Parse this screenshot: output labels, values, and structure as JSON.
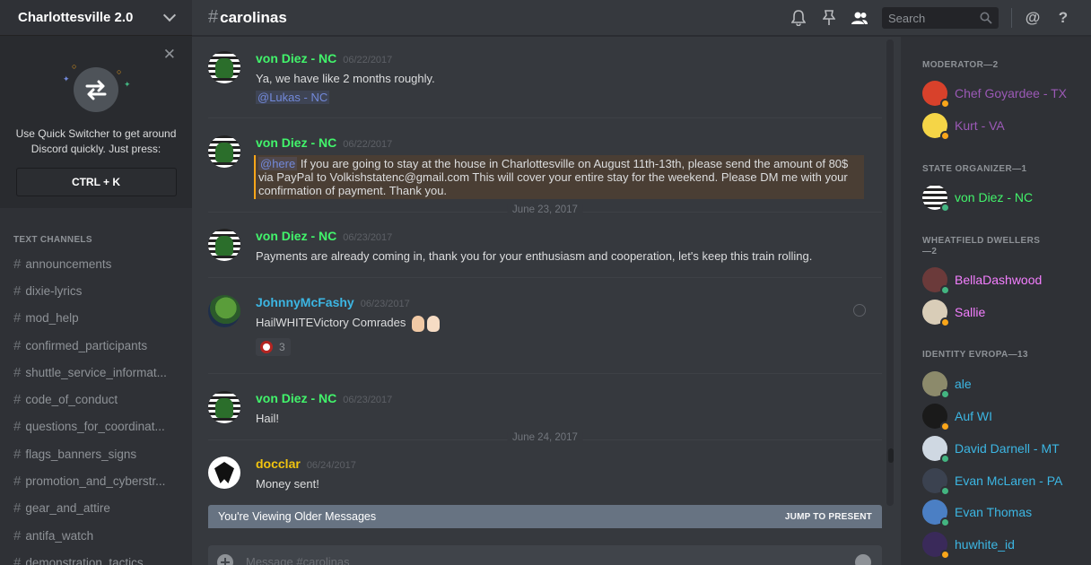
{
  "server": {
    "name": "Charlottesville 2.0"
  },
  "quick_switcher": {
    "text": "Use Quick Switcher to get around Discord quickly. Just press:",
    "shortcut": "CTRL + K"
  },
  "sidebar": {
    "category": "TEXT CHANNELS",
    "channels": [
      "announcements",
      "dixie-lyrics",
      "mod_help",
      "confirmed_participants",
      "shuttle_service_informat...",
      "code_of_conduct",
      "questions_for_coordinat...",
      "flags_banners_signs",
      "promotion_and_cyberstr...",
      "gear_and_attire",
      "antifa_watch",
      "demonstration_tactics"
    ]
  },
  "header": {
    "hash": "#",
    "channel": "carolinas",
    "search_placeholder": "Search"
  },
  "messages": [
    {
      "author": "von Diez - NC",
      "author_color": "#42f46b",
      "time": "06/22/2017",
      "lines": [
        "Ya, we have like 2 months roughly."
      ],
      "mention": "@Lukas - NC"
    },
    {
      "author": "von Diez - NC",
      "author_color": "#42f46b",
      "time": "06/22/2017",
      "here": "@here",
      "highlight_text": " If you are going to stay at the house in Charlottesville on August 11th-13th, please send the amount of 80$ via PayPal to Volkishstatenc@gmail.com This will cover your entire stay for the weekend. Please DM me with your confirmation of payment. Thank you."
    },
    {
      "author": "von Diez - NC",
      "author_color": "#42f46b",
      "time": "06/23/2017",
      "lines": [
        "Payments are already coming in, thank you for your enthusiasm and cooperation, let's keep this train rolling."
      ]
    },
    {
      "author": "JohnnyMcFashy",
      "author_color": "#3cb6e3",
      "time": "06/23/2017",
      "lines": [
        "HailWHITEVictory Comrades"
      ],
      "reaction_count": "3"
    },
    {
      "author": "von Diez - NC",
      "author_color": "#42f46b",
      "time": "06/23/2017",
      "lines": [
        "Hail!"
      ]
    },
    {
      "author": "docclar",
      "author_color": "#f1c40f",
      "time": "06/24/2017",
      "lines": [
        "Money sent!"
      ]
    }
  ],
  "date_dividers": [
    "June 23, 2017",
    "June 24, 2017"
  ],
  "older_bar": {
    "text": "You're Viewing Older Messages",
    "jump": "JUMP TO PRESENT"
  },
  "composer": {
    "placeholder": "Message #carolinas"
  },
  "members": {
    "roles": [
      {
        "title": "MODERATOR—2",
        "members": [
          {
            "name": "Chef Goyardee - TX",
            "color": "#9b59b6",
            "status": "#faa61a"
          },
          {
            "name": "Kurt - VA",
            "color": "#9b59b6",
            "status": "#faa61a"
          }
        ]
      },
      {
        "title": "STATE ORGANIZER—1",
        "members": [
          {
            "name": "von Diez - NC",
            "color": "#42f46b",
            "status": "#43b581"
          }
        ]
      },
      {
        "title": "WHEATFIELD DWELLERS—2",
        "members": [
          {
            "name": "BellaDashwood",
            "color": "#f47fff",
            "status": "#43b581"
          },
          {
            "name": "Sallie",
            "color": "#f47fff",
            "status": "#faa61a"
          }
        ]
      },
      {
        "title": "IDENTITY EVROPA—13",
        "members": [
          {
            "name": "ale",
            "color": "#3cb6e3",
            "status": "#43b581"
          },
          {
            "name": "Auf WI",
            "color": "#3cb6e3",
            "status": "#faa61a"
          },
          {
            "name": "David Darnell - MT",
            "color": "#3cb6e3",
            "status": "#43b581"
          },
          {
            "name": "Evan McLaren - PA",
            "color": "#3cb6e3",
            "status": "#43b581"
          },
          {
            "name": "Evan Thomas",
            "color": "#3cb6e3",
            "status": "#43b581"
          },
          {
            "name": "huwhite_id",
            "color": "#3cb6e3",
            "status": "#faa61a"
          }
        ]
      }
    ]
  }
}
